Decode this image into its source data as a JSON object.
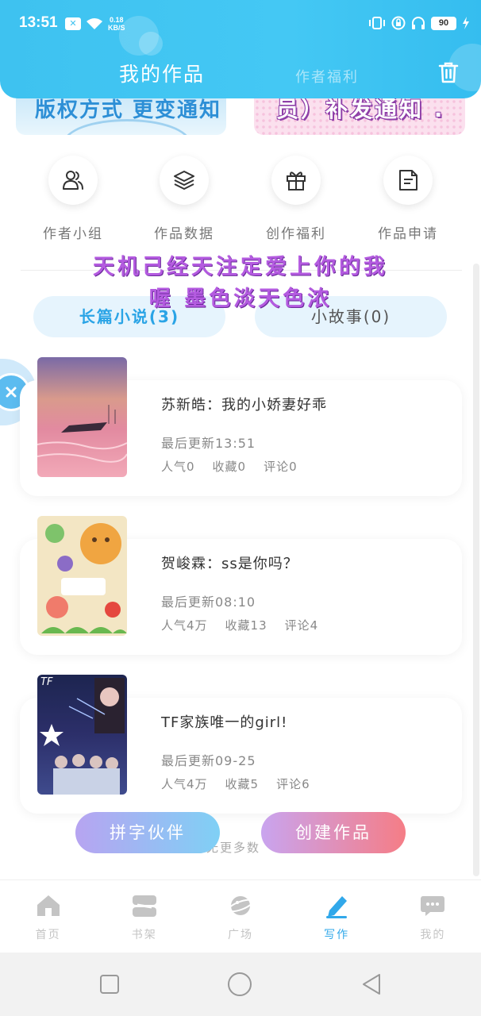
{
  "status_bar": {
    "time": "13:51",
    "net_speed_value": "0.18",
    "net_speed_unit": "KB/S",
    "battery": "90"
  },
  "header": {
    "tab_active": "我的作品",
    "tab_inactive": "作者福利",
    "delete_icon": "trash-icon"
  },
  "banners": {
    "left_text": "版权方式 更变通知",
    "right_text": "员）补发通知 ."
  },
  "quick_actions": [
    {
      "label": "作者小组",
      "icon": "people-icon"
    },
    {
      "label": "作品数据",
      "icon": "layers-icon"
    },
    {
      "label": "创作福利",
      "icon": "gift-icon"
    },
    {
      "label": "作品申请",
      "icon": "document-icon"
    }
  ],
  "overlay_text": {
    "line1": "天机己经天注定爱上你的我",
    "line2": "喔 墨色淡天色浓"
  },
  "segments": {
    "long_novel": "长篇小说(3)",
    "short_story": "小故事(0)"
  },
  "works": [
    {
      "title": "苏新皓：我的小娇妻好乖",
      "updated": "最后更新13:51",
      "popularity": "人气0",
      "favorites": "收藏0",
      "comments": "评论0"
    },
    {
      "title": "贺峻霖：ss是你吗？",
      "updated": "最后更新08:10",
      "popularity": "人气4万",
      "favorites": "收藏13",
      "comments": "评论4"
    },
    {
      "title": "TF家族唯一的girl!",
      "updated": "最后更新09-25",
      "popularity": "人气4万",
      "favorites": "收藏5",
      "comments": "评论6"
    }
  ],
  "buttons": {
    "partner": "拼字伙伴",
    "create": "创建作品"
  },
  "list_footer": "无更多数",
  "bottom_nav": [
    {
      "label": "首页",
      "icon": "home-icon"
    },
    {
      "label": "书架",
      "icon": "bookshelf-icon"
    },
    {
      "label": "广场",
      "icon": "planet-icon"
    },
    {
      "label": "写作",
      "icon": "pen-icon"
    },
    {
      "label": "我的",
      "icon": "chat-bubble-icon"
    }
  ],
  "colors": {
    "header": "#3ec2f0",
    "accent": "#31a8ea",
    "overlay": "#b45be0"
  }
}
